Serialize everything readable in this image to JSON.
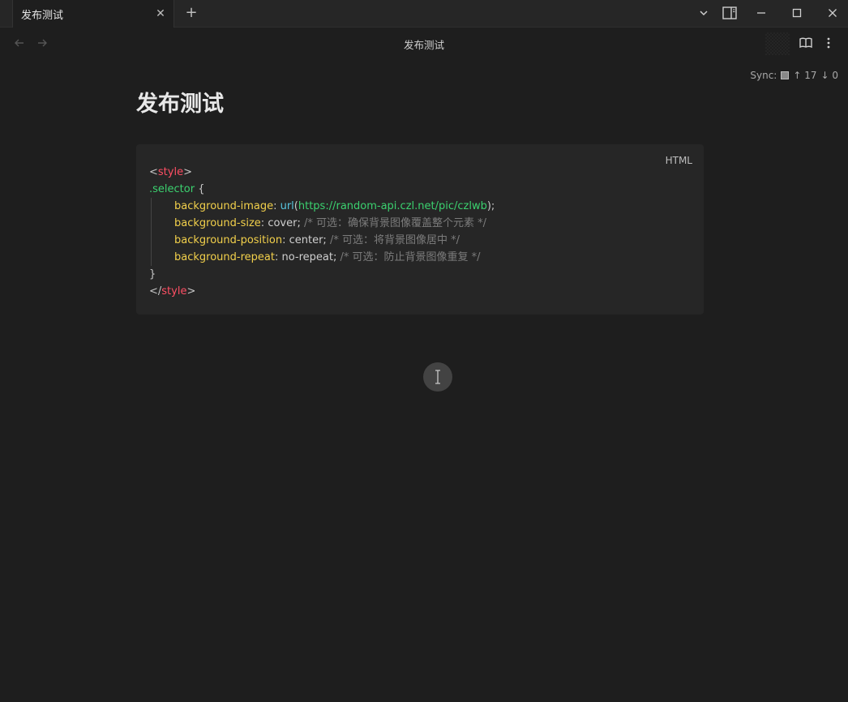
{
  "tab": {
    "title": "发布测试"
  },
  "view": {
    "title": "发布测试"
  },
  "sync": {
    "label": "Sync:",
    "up": "↑ 17",
    "down": "↓ 0"
  },
  "note": {
    "title": "发布测试",
    "code": {
      "language": "HTML",
      "open_lt": "<",
      "tag": "style",
      "open_gt": ">",
      "selector": ".selector",
      "brace_open": " {",
      "bg_image_prop": "background-image",
      "colon": ": ",
      "fn_url": "url",
      "paren_open": "(",
      "url_value": "https://random-api.czl.net/pic/czlwb",
      "paren_close": ");",
      "bg_size_prop": "background-size",
      "bg_size_val": "cover;",
      "bg_size_comment": " /* 可选：确保背景图像覆盖整个元素 */",
      "bg_pos_prop": "background-position",
      "bg_pos_val": "center;",
      "bg_pos_comment": " /* 可选：将背景图像居中 */",
      "bg_rep_prop": "background-repeat",
      "bg_rep_val": "no-repeat;",
      "bg_rep_comment": " /* 可选：防止背景图像重复 */",
      "brace_close": "}",
      "close_lt": "</"
    }
  },
  "icons": {
    "close": "close-icon",
    "plus": "plus-icon",
    "chevron": "chevron-down-icon",
    "sidebar": "sidebar-toggle-icon",
    "minimize": "minimize-icon",
    "maximize": "maximize-icon",
    "back": "arrow-left-icon",
    "forward": "arrow-right-icon",
    "reading": "book-open-icon",
    "more": "more-vertical-icon"
  }
}
